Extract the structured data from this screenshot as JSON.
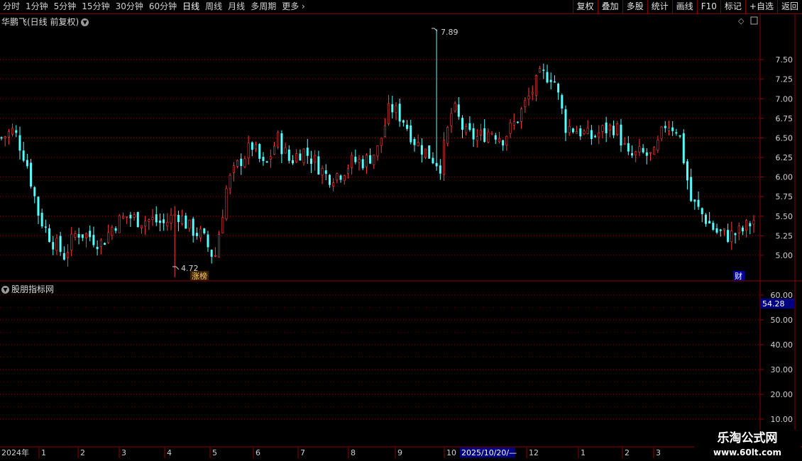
{
  "toolbar": {
    "periods": [
      "分时",
      "1分钟",
      "5分钟",
      "15分钟",
      "30分钟",
      "60分钟",
      "日线",
      "周线",
      "月线",
      "多周期",
      "更多 ›"
    ],
    "active": "日线",
    "actions": [
      "复权",
      "叠加",
      "多股",
      "统计",
      "画线",
      "F10",
      "标记",
      "+自选",
      "返回"
    ]
  },
  "price_pane": {
    "title": "华鹏飞(日线 前复权)",
    "price_ticks": [
      "7.50",
      "7.25",
      "7.00",
      "6.75",
      "6.50",
      "6.25",
      "6.00",
      "5.75",
      "5.50",
      "5.25",
      "5.00"
    ],
    "high_label": "7.89",
    "low_label": "4.72",
    "badge_zhangbang": "涨榜",
    "badge_cai": "财"
  },
  "indicator_pane": {
    "title": "股朋指标网",
    "ticks": [
      "60.00",
      "50.00",
      "40.00",
      "30.00",
      "20.00",
      "10.00"
    ],
    "current_value": "54.28"
  },
  "time_axis": {
    "year_label": "2024年",
    "months": [
      "1",
      "2",
      "3",
      "4",
      "5",
      "6",
      "7",
      "8",
      "9",
      "10",
      "12",
      "1",
      "2",
      "3"
    ],
    "cursor_date": "2025/10/20/—"
  },
  "watermark": {
    "line1": "乐淘公式网",
    "line2": "www.60lt.com"
  },
  "colors": {
    "up": "#ff3d3d",
    "down": "#54ffff",
    "grid": "#8b0000",
    "highlight_box": "#000080"
  },
  "chart_data": {
    "type": "candlestick",
    "y_unit": "price",
    "ylim": [
      4.7,
      7.9
    ],
    "approx_close_path": [
      6.5,
      6.6,
      6.2,
      5.5,
      5.2,
      5.0,
      5.3,
      5.25,
      5.15,
      5.4,
      5.5,
      5.45,
      5.45,
      5.4,
      5.55,
      5.35,
      5.25,
      4.95,
      5.9,
      6.2,
      6.4,
      6.1,
      6.5,
      6.2,
      6.35,
      6.2,
      6.0,
      6.05,
      6.2,
      6.2,
      6.35,
      6.9,
      6.75,
      6.45,
      6.3,
      6.15,
      6.9,
      6.55,
      6.5,
      6.6,
      6.5,
      6.7,
      7.0,
      7.3,
      7.3,
      6.65,
      6.6,
      6.5,
      6.6,
      6.65,
      6.25,
      6.3,
      6.25,
      6.7,
      6.6,
      5.7,
      5.5,
      5.3,
      5.25,
      5.3,
      5.45
    ],
    "high": 7.89,
    "low": 4.72
  }
}
